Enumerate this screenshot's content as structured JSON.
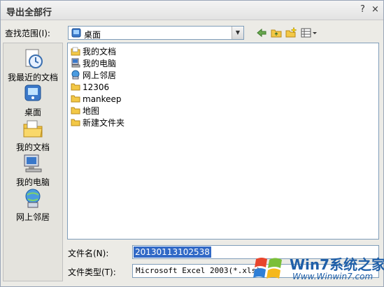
{
  "dialog": {
    "title": "导出全部行",
    "help_button": "?",
    "close_button": "×"
  },
  "lookin": {
    "label": "查找范围(I):",
    "value": "桌面"
  },
  "places": [
    {
      "label": "我最近的文档",
      "icon": "recent-documents-icon"
    },
    {
      "label": "桌面",
      "icon": "desktop-icon"
    },
    {
      "label": "我的文档",
      "icon": "my-documents-icon"
    },
    {
      "label": "我的电脑",
      "icon": "my-computer-icon"
    },
    {
      "label": "网上邻居",
      "icon": "network-places-icon"
    }
  ],
  "files": [
    {
      "name": "我的文档",
      "icon": "my-documents-icon"
    },
    {
      "name": "我的电脑",
      "icon": "my-computer-icon"
    },
    {
      "name": "网上邻居",
      "icon": "network-places-icon"
    },
    {
      "name": "12306",
      "icon": "folder-icon"
    },
    {
      "name": "mankeep",
      "icon": "folder-icon"
    },
    {
      "name": "地图",
      "icon": "folder-icon"
    },
    {
      "name": "新建文件夹",
      "icon": "folder-icon"
    }
  ],
  "filename": {
    "label": "文件名(N):",
    "value": "20130113102538"
  },
  "filetype": {
    "label": "文件类型(T):",
    "value": "Microsoft Excel 2003(*.xls)"
  },
  "watermark": {
    "brand": "Win7系统之家",
    "url": "Www.Winwin7.com"
  },
  "colors": {
    "selection": "#3169c6",
    "folder": "#f3c846"
  }
}
